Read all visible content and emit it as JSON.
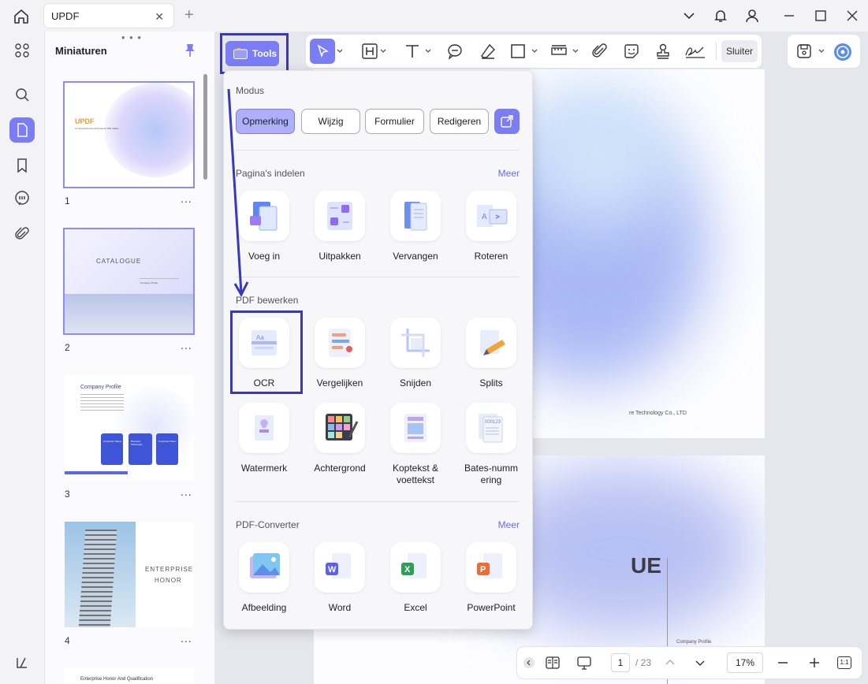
{
  "tab": {
    "title": "UPDF",
    "close": "✕",
    "add": "+"
  },
  "thumbnails": {
    "title": "Miniaturen",
    "more": "...",
    "pages": [
      {
        "num": "1",
        "brand": "UPDF",
        "subtitle": "A Comprehensive AI-Powered PDF Editor"
      },
      {
        "num": "2",
        "heading": "CATALOGUE",
        "item": "Company Profile"
      },
      {
        "num": "3",
        "heading": "Company Profile",
        "cards": [
          "Corporate Values",
          "Business Philosophy",
          "Corporate Vision"
        ]
      },
      {
        "num": "4",
        "heading_line1": "ENTERPRISE",
        "heading_line2": "HONOR"
      },
      {
        "num": "",
        "heading": "Enterprise Honor And Qualification"
      }
    ]
  },
  "toolbar": {
    "tools_label": "Tools",
    "close_label": "Sluiter"
  },
  "document": {
    "footer_text": "re Technology Co., LTD",
    "big_text": "UE",
    "list_item": "Company Profile"
  },
  "bottom": {
    "page": "1",
    "total": "/ 23",
    "zoom": "17%",
    "fit": "1:1"
  },
  "popup": {
    "mode_title": "Modus",
    "modes": [
      "Opmerking",
      "Wijzig",
      "Formulier",
      "Redigeren"
    ],
    "pages_title": "Pagina's indelen",
    "pages_more": "Meer",
    "pages_tools": [
      "Voeg in",
      "Uitpakken",
      "Vervangen",
      "Roteren"
    ],
    "edit_title": "PDF bewerken",
    "edit_tools": [
      "OCR",
      "Vergelijken",
      "Snijden",
      "Splits",
      "Watermerk",
      "Achtergrond",
      "Koptekst & voettekst",
      "Bates-numm ering"
    ],
    "converter_title": "PDF-Converter",
    "converter_more": "Meer",
    "converter_tools": [
      "Afbeelding",
      "Word",
      "Excel",
      "PowerPoint"
    ]
  },
  "colors": {
    "accent": "#7b7df4",
    "annotation": "#3a38b9"
  }
}
